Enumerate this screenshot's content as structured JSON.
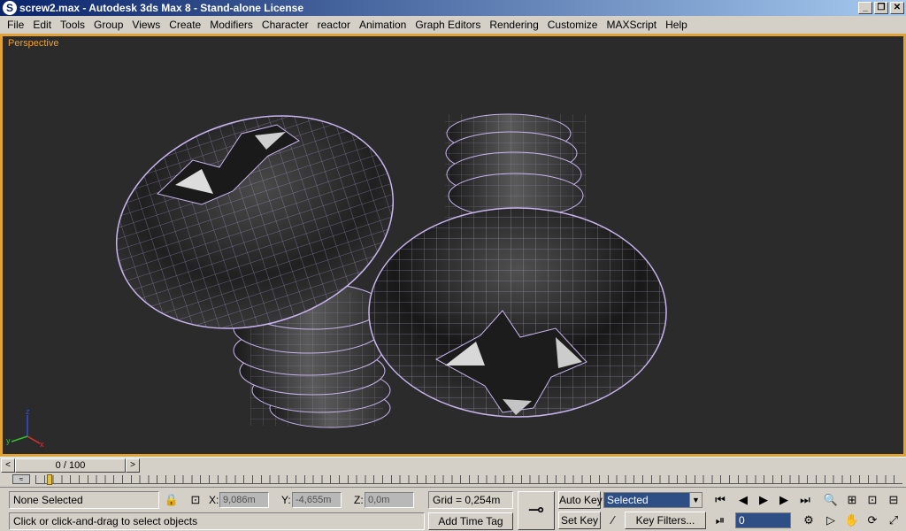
{
  "window": {
    "title": "screw2.max - Autodesk 3ds Max 8  - Stand-alone License",
    "app_icon": "3dsmax-icon",
    "buttons": {
      "minimize": "_",
      "restore": "❐",
      "close": "✕"
    }
  },
  "menu": {
    "items": [
      "File",
      "Edit",
      "Tools",
      "Group",
      "Views",
      "Create",
      "Modifiers",
      "Character",
      "reactor",
      "Animation",
      "Graph Editors",
      "Rendering",
      "Customize",
      "MAXScript",
      "Help"
    ]
  },
  "viewport": {
    "label": "Perspective",
    "border_color": "#e1a336",
    "wire_color": "#c8b4f0",
    "axis": {
      "x": "x",
      "y": "y",
      "z": "z"
    }
  },
  "timeline": {
    "slider_text": "0 / 100",
    "left_arrow": "<",
    "right_arrow": ">"
  },
  "status": {
    "selection": "None Selected",
    "prompt": "Click or click-and-drag to select objects",
    "x_label": "X:",
    "x_value": "9,086m",
    "y_label": "Y:",
    "y_value": "-4,655m",
    "z_label": "Z:",
    "z_value": "0,0m",
    "grid": "Grid = 0,254m",
    "add_time_tag": "Add Time Tag",
    "auto_key": "Auto Key",
    "set_key": "Set Key",
    "selected_option": "Selected",
    "key_filters": "Key Filters...",
    "current_frame": "0"
  },
  "icons": {
    "lock": "🔒",
    "snap": "⊡",
    "key": "⊸",
    "curve": "⁄",
    "go_start": "⏮",
    "prev_frame": "◀",
    "play": "▶",
    "next_frame": "▶",
    "go_end": "⏭",
    "key_mode": "⏯",
    "time_config": "⚙",
    "zoom": "🔍",
    "zoom_all": "⊞",
    "zoom_extents": "⊡",
    "zoom_extents_all": "⊟",
    "fov": "▷",
    "pan": "✋",
    "orbit": "⟳",
    "maximize": "⤢"
  }
}
